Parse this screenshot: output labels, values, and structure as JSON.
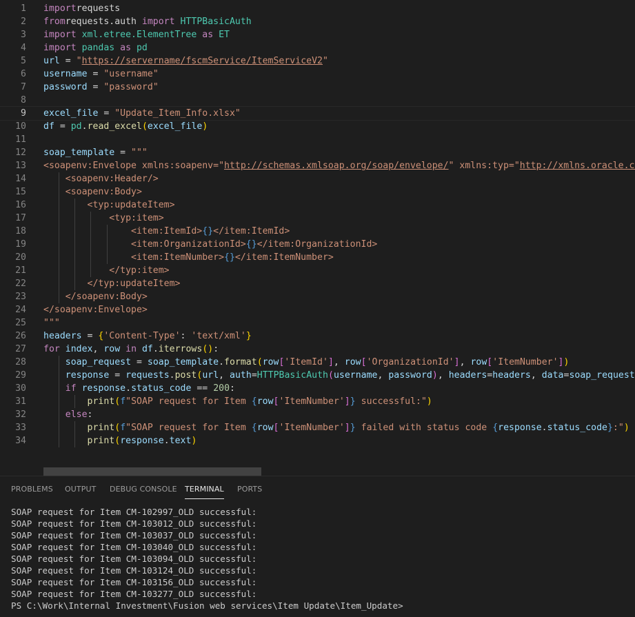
{
  "editor": {
    "current_line": 9,
    "lines": [
      [
        [
          "kw",
          "import"
        ],
        [
          "",
          "requests"
        ]
      ],
      [
        [
          "kw",
          "from"
        ],
        [
          "",
          "requests.auth "
        ],
        [
          "kw",
          "import"
        ],
        [
          "cls",
          " HTTPBasicAuth"
        ]
      ],
      [
        [
          "kw",
          "import"
        ],
        [
          "cls",
          " xml.etree.ElementTree"
        ],
        [
          "kw",
          " as"
        ],
        [
          "cls",
          " ET"
        ]
      ],
      [
        [
          "kw",
          "import"
        ],
        [
          "cls",
          " pandas"
        ],
        [
          "kw",
          " as"
        ],
        [
          "cls",
          " pd"
        ]
      ],
      [
        [
          "var",
          "url"
        ],
        [
          "",
          " = "
        ],
        [
          "str",
          "\""
        ],
        [
          "lnk",
          "https://servername/fscmService/ItemServiceV2"
        ],
        [
          "str",
          "\""
        ]
      ],
      [
        [
          "var",
          "username"
        ],
        [
          "",
          " = "
        ],
        [
          "str",
          "\"username\""
        ]
      ],
      [
        [
          "var",
          "password"
        ],
        [
          "",
          " = "
        ],
        [
          "str",
          "\"password\""
        ]
      ],
      [],
      [
        [
          "var",
          "excel_file"
        ],
        [
          "",
          " = "
        ],
        [
          "str",
          "\"Update_Item_Info.xlsx\""
        ]
      ],
      [
        [
          "var",
          "df"
        ],
        [
          "",
          " = "
        ],
        [
          "cls",
          "pd"
        ],
        [
          "",
          "."
        ],
        [
          "fn",
          "read_excel"
        ],
        [
          "br1",
          "("
        ],
        [
          "var",
          "excel_file"
        ],
        [
          "br1",
          ")"
        ]
      ],
      [],
      [
        [
          "var",
          "soap_template"
        ],
        [
          "",
          " = "
        ],
        [
          "str",
          "\"\"\""
        ]
      ],
      [
        [
          "str",
          "<soapenv:Envelope xmlns:soapenv=\""
        ],
        [
          "lnk",
          "http://schemas.xmlsoap.org/soap/envelope/"
        ],
        [
          "str",
          "\" xmlns:typ=\""
        ],
        [
          "lnk",
          "http://xmlns.oracle.com/apps/scm"
        ]
      ],
      [
        [
          "str",
          "    <soapenv:Header/>"
        ]
      ],
      [
        [
          "str",
          "    <soapenv:Body>"
        ]
      ],
      [
        [
          "str",
          "        <typ:updateItem>"
        ]
      ],
      [
        [
          "str",
          "            <typ:item>"
        ]
      ],
      [
        [
          "str",
          "                <item:ItemId>"
        ],
        [
          "kwb",
          "{}"
        ],
        [
          "str",
          "</item:ItemId>"
        ]
      ],
      [
        [
          "str",
          "                <item:OrganizationId>"
        ],
        [
          "kwb",
          "{}"
        ],
        [
          "str",
          "</item:OrganizationId>"
        ]
      ],
      [
        [
          "str",
          "                <item:ItemNumber>"
        ],
        [
          "kwb",
          "{}"
        ],
        [
          "str",
          "</item:ItemNumber>"
        ]
      ],
      [
        [
          "str",
          "            </typ:item>"
        ]
      ],
      [
        [
          "str",
          "        </typ:updateItem>"
        ]
      ],
      [
        [
          "str",
          "    </soapenv:Body>"
        ]
      ],
      [
        [
          "str",
          "</soapenv:Envelope>"
        ]
      ],
      [
        [
          "str",
          "\"\"\""
        ]
      ],
      [
        [
          "var",
          "headers"
        ],
        [
          "",
          " = "
        ],
        [
          "br1",
          "{"
        ],
        [
          "str",
          "'Content-Type'"
        ],
        [
          "",
          ": "
        ],
        [
          "str",
          "'text/xml'"
        ],
        [
          "br1",
          "}"
        ]
      ],
      [
        [
          "kw",
          "for"
        ],
        [
          "var",
          " index"
        ],
        [
          "",
          ", "
        ],
        [
          "var",
          "row"
        ],
        [
          "kw",
          " in"
        ],
        [
          "var",
          " df"
        ],
        [
          "",
          "."
        ],
        [
          "fn",
          "iterrows"
        ],
        [
          "br1",
          "()"
        ],
        [
          "",
          ":"
        ]
      ],
      [
        [
          "",
          "    "
        ],
        [
          "var",
          "soap_request"
        ],
        [
          "",
          " = "
        ],
        [
          "var",
          "soap_template"
        ],
        [
          "",
          "."
        ],
        [
          "fn",
          "format"
        ],
        [
          "br1",
          "("
        ],
        [
          "var",
          "row"
        ],
        [
          "br2",
          "["
        ],
        [
          "str",
          "'ItemId'"
        ],
        [
          "br2",
          "]"
        ],
        [
          "",
          ", "
        ],
        [
          "var",
          "row"
        ],
        [
          "br2",
          "["
        ],
        [
          "str",
          "'OrganizationId'"
        ],
        [
          "br2",
          "]"
        ],
        [
          "",
          ", "
        ],
        [
          "var",
          "row"
        ],
        [
          "br2",
          "["
        ],
        [
          "str",
          "'ItemNumber'"
        ],
        [
          "br2",
          "]"
        ],
        [
          "br1",
          ")"
        ]
      ],
      [
        [
          "",
          "    "
        ],
        [
          "var",
          "response"
        ],
        [
          "",
          " = "
        ],
        [
          "var",
          "requests"
        ],
        [
          "",
          "."
        ],
        [
          "fn",
          "post"
        ],
        [
          "br1",
          "("
        ],
        [
          "var",
          "url"
        ],
        [
          "",
          ", "
        ],
        [
          "var",
          "auth"
        ],
        [
          "",
          "="
        ],
        [
          "cls",
          "HTTPBasicAuth"
        ],
        [
          "br2",
          "("
        ],
        [
          "var",
          "username"
        ],
        [
          "",
          ", "
        ],
        [
          "var",
          "password"
        ],
        [
          "br2",
          ")"
        ],
        [
          "",
          ", "
        ],
        [
          "var",
          "headers"
        ],
        [
          "",
          "="
        ],
        [
          "var",
          "headers"
        ],
        [
          "",
          ", "
        ],
        [
          "var",
          "data"
        ],
        [
          "",
          "="
        ],
        [
          "var",
          "soap_request"
        ],
        [
          "br1",
          ")"
        ]
      ],
      [
        [
          "",
          "    "
        ],
        [
          "kw",
          "if"
        ],
        [
          "var",
          " response"
        ],
        [
          "",
          "."
        ],
        [
          "var",
          "status_code"
        ],
        [
          "",
          " == "
        ],
        [
          "num",
          "200"
        ],
        [
          "",
          ":"
        ]
      ],
      [
        [
          "",
          "        "
        ],
        [
          "fn",
          "print"
        ],
        [
          "br1",
          "("
        ],
        [
          "kwb",
          "f"
        ],
        [
          "str",
          "\"SOAP request for Item "
        ],
        [
          "kwb",
          "{"
        ],
        [
          "var",
          "row"
        ],
        [
          "br2",
          "["
        ],
        [
          "str",
          "'ItemNumber'"
        ],
        [
          "br2",
          "]"
        ],
        [
          "kwb",
          "}"
        ],
        [
          "str",
          " successful:\""
        ],
        [
          "br1",
          ")"
        ]
      ],
      [
        [
          "",
          "    "
        ],
        [
          "kw",
          "else"
        ],
        [
          "",
          ":"
        ]
      ],
      [
        [
          "",
          "        "
        ],
        [
          "fn",
          "print"
        ],
        [
          "br1",
          "("
        ],
        [
          "kwb",
          "f"
        ],
        [
          "str",
          "\"SOAP request for Item "
        ],
        [
          "kwb",
          "{"
        ],
        [
          "var",
          "row"
        ],
        [
          "br2",
          "["
        ],
        [
          "str",
          "'ItemNumber'"
        ],
        [
          "br2",
          "]"
        ],
        [
          "kwb",
          "}"
        ],
        [
          "str",
          " failed with status code "
        ],
        [
          "kwb",
          "{"
        ],
        [
          "var",
          "response"
        ],
        [
          "",
          "."
        ],
        [
          "var",
          "status_code"
        ],
        [
          "kwb",
          "}"
        ],
        [
          "str",
          ":\""
        ],
        [
          "br1",
          ")"
        ]
      ],
      [
        [
          "",
          "        "
        ],
        [
          "fn",
          "print"
        ],
        [
          "br1",
          "("
        ],
        [
          "var",
          "response"
        ],
        [
          "",
          "."
        ],
        [
          "var",
          "text"
        ],
        [
          "br1",
          ")"
        ]
      ]
    ]
  },
  "panel": {
    "tabs": [
      "PROBLEMS",
      "OUTPUT",
      "DEBUG CONSOLE",
      "TERMINAL",
      "PORTS"
    ],
    "active_tab": "TERMINAL",
    "terminal_lines": [
      "SOAP request for Item CM-102997_OLD successful:",
      "SOAP request for Item CM-103012_OLD successful:",
      "SOAP request for Item CM-103037_OLD successful:",
      "SOAP request for Item CM-103040_OLD successful:",
      "SOAP request for Item CM-103094_OLD successful:",
      "SOAP request for Item CM-103124_OLD successful:",
      "SOAP request for Item CM-103156_OLD successful:",
      "SOAP request for Item CM-103277_OLD successful:",
      "PS C:\\Work\\Internal Investment\\Fusion web services\\Item Update\\Item_Update>"
    ]
  }
}
